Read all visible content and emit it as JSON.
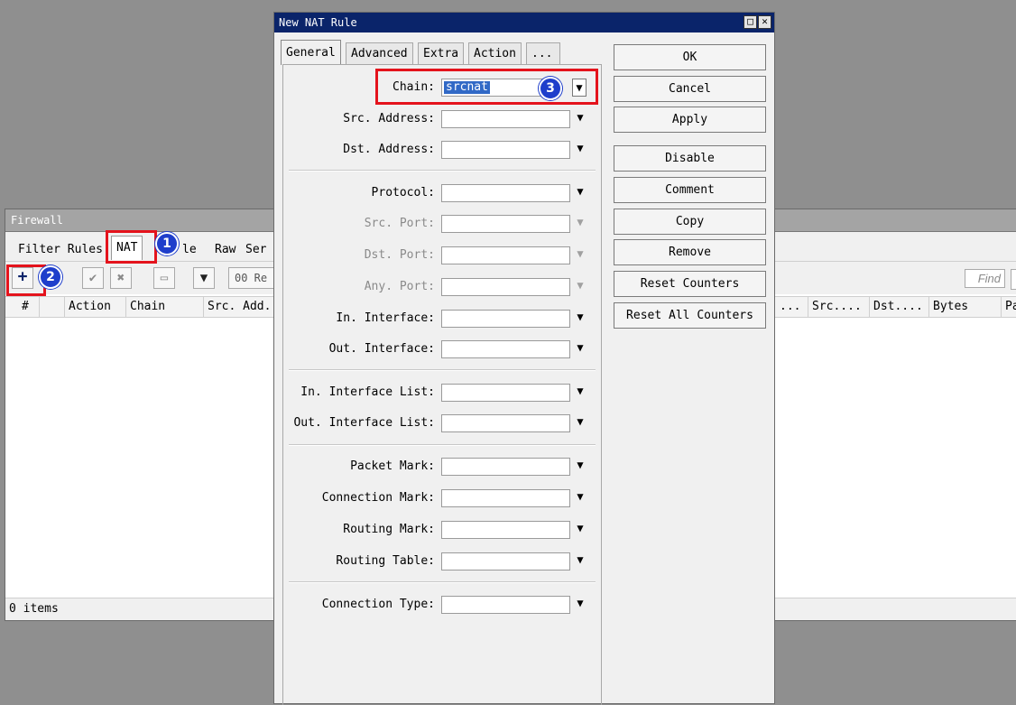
{
  "firewall": {
    "title": "Firewall",
    "tabs": [
      "Filter Rules",
      "NAT",
      "le",
      "Raw",
      "Ser"
    ],
    "toolbar": {
      "add_glyph": "+",
      "enable_glyph": "✔",
      "disable_glyph": "✖",
      "comment_glyph": "▭",
      "filter_glyph": "▼",
      "reset_label": "00 Re",
      "find_placeholder": "Find"
    },
    "columns_left": [
      "#",
      "",
      "Action",
      "Chain",
      "Src. Add."
    ],
    "columns_right": [
      "...",
      "Src....",
      "Dst....",
      "Bytes",
      "Pa"
    ],
    "status": "0 items"
  },
  "dialog": {
    "title": "New NAT Rule",
    "tabs": [
      "General",
      "Advanced",
      "Extra",
      "Action",
      "..."
    ],
    "fields": {
      "chain_label": "Chain:",
      "chain_value": "srcnat",
      "src_address": "Src. Address:",
      "dst_address": "Dst. Address:",
      "protocol": "Protocol:",
      "src_port": "Src. Port:",
      "dst_port": "Dst. Port:",
      "any_port": "Any. Port:",
      "in_interface": "In. Interface:",
      "out_interface": "Out. Interface:",
      "in_interface_list": "In. Interface List:",
      "out_interface_list": "Out. Interface List:",
      "packet_mark": "Packet Mark:",
      "connection_mark": "Connection Mark:",
      "routing_mark": "Routing Mark:",
      "routing_table": "Routing Table:",
      "connection_type": "Connection Type:"
    },
    "buttons": {
      "ok": "OK",
      "cancel": "Cancel",
      "apply": "Apply",
      "disable": "Disable",
      "comment": "Comment",
      "copy": "Copy",
      "remove": "Remove",
      "reset_counters": "Reset Counters",
      "reset_all_counters": "Reset All Counters"
    },
    "window_buttons": {
      "maximize": "□",
      "close": "✕"
    }
  },
  "annotations": {
    "badge1": "1",
    "badge2": "2",
    "badge3": "3"
  },
  "colors": {
    "annotation_red": "#e4131c",
    "badge_blue": "#1e3ecb",
    "title_blue": "#0a246a",
    "selection_blue": "#3169c6"
  }
}
